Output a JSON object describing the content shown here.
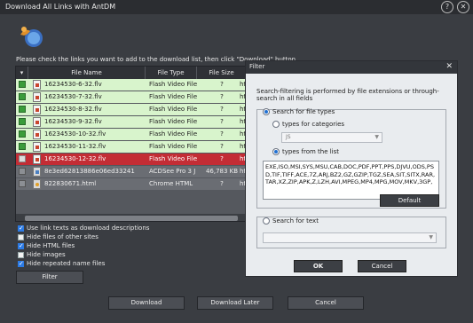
{
  "window": {
    "title": "Download All Links with AntDM"
  },
  "titlebar_buttons": {
    "help": "?",
    "close": "✕"
  },
  "instruction": "Please check the links you want to add to the download list, then click \"Download\" button.",
  "table": {
    "columns": [
      "File Name",
      "File Type",
      "File Size",
      "Link"
    ],
    "rows": [
      {
        "name": "16234530-6-32.flv",
        "type": "Flash Video File",
        "size": "?",
        "link": "http",
        "state": "green"
      },
      {
        "name": "16234530-7-32.flv",
        "type": "Flash Video File",
        "size": "?",
        "link": "http",
        "state": "green"
      },
      {
        "name": "16234530-8-32.flv",
        "type": "Flash Video File",
        "size": "?",
        "link": "http",
        "state": "green"
      },
      {
        "name": "16234530-9-32.flv",
        "type": "Flash Video File",
        "size": "?",
        "link": "http",
        "state": "green"
      },
      {
        "name": "16234530-10-32.flv",
        "type": "Flash Video File",
        "size": "?",
        "link": "http",
        "state": "green"
      },
      {
        "name": "16234530-11-32.flv",
        "type": "Flash Video File",
        "size": "?",
        "link": "http",
        "state": "green"
      },
      {
        "name": "16234530-12-32.flv",
        "type": "Flash Video File",
        "size": "?",
        "link": "http",
        "state": "red"
      },
      {
        "name": "8e3ed62813886e06ed33241",
        "type": "ACDSee Pro 3 J",
        "size": "46,783 KB",
        "link": "http",
        "state": "gray"
      },
      {
        "name": "822830671.html",
        "type": "Chrome HTML",
        "size": "?",
        "link": "http",
        "state": "gray"
      }
    ]
  },
  "options": [
    {
      "label": "Use link texts as download descriptions",
      "checked": true
    },
    {
      "label": "Hide files of other sites",
      "checked": false
    },
    {
      "label": "Hide HTML files",
      "checked": true
    },
    {
      "label": "Hide images",
      "checked": false
    },
    {
      "label": "Hide repeated name files",
      "checked": true
    }
  ],
  "filter_button": "Filter",
  "footer": {
    "download": "Download",
    "download_later": "Download Later",
    "cancel": "Cancel"
  },
  "filter_dialog": {
    "title": "Filter",
    "close": "✕",
    "info": "Search-filtering is performed by file extensions or through-search in all fields",
    "search_types_label": "Search for file types",
    "types_categories_label": "types for categories",
    "category_value": "JS",
    "types_list_label": "types from the list",
    "extensions": "EXE,ISO,MSI,SYS,MSU,CAB,DOC,PDF,PPT,PPS,DJVU,ODS,PSD,TIF,TIFF,ACE,7Z,ARJ,BZ2,GZ,GZIP,TGZ,SEA,SIT,SITX,RAR,TAR,XZ,ZIP,APK,Z,LZH,AVI,MPEG,MP4,MPG,MOV,MKV,3GP,",
    "default_button": "Default",
    "search_text_label": "Search for text",
    "text_value": "",
    "ok_button": "OK",
    "cancel_button": "Cancel"
  },
  "colors": {
    "accent": "#2c7be5",
    "selected_row": "#c32d35",
    "checked_row": "#d8f4cc"
  }
}
